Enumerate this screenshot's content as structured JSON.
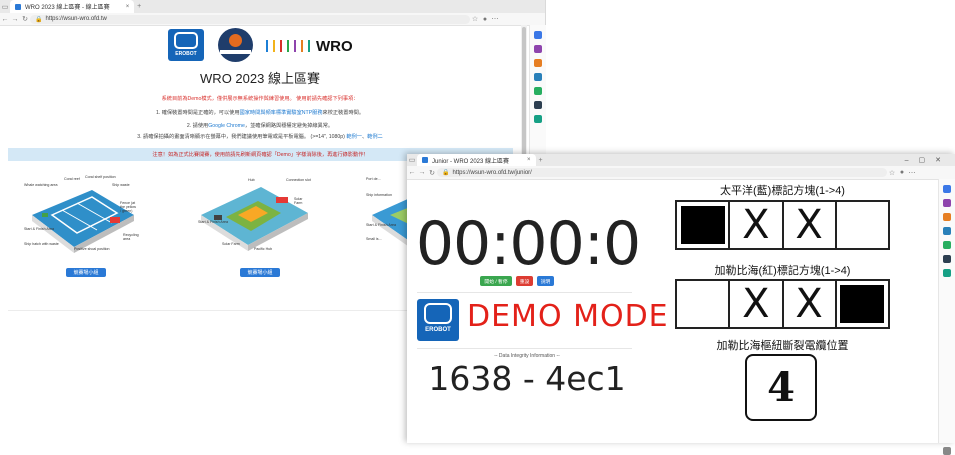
{
  "windowA": {
    "tab_title": "WRO 2023 線上區賽 - 線上區賽",
    "url": "https://wsun-wro.ofd.tw",
    "page_title": "WRO 2023 線上區賽",
    "logo_erobot": "EROBOT",
    "logo_wro": "WRO",
    "notice_red": "系統目前為Demo模式，僅供展示無系統操作與練習使用。 使用前請先確認下列事項：",
    "line1_pre": "1. 確保裝置時間是正確的，可以使用",
    "line1_link": "國家時間與頻率標準實驗室NTP服務",
    "line1_post": "來校正裝置時間。",
    "line2_pre": "2. 請使用",
    "line2_link": "Google Chrome",
    "line2_post": "，並確保網路與穩權定避免掉線異常。",
    "line3_pre": "3. 請確保拍攝的畫面清晰顯示在螢幕中，我們建議使用筆電或是平板電腦。 (>=14\", 1080p)",
    "line3_link1": "範例一",
    "line3_link2": "範例二",
    "notice_bar": "注意！如為正式比賽開賽，使用前請先刷新網頁確認「Demo」字樣消除後，再進行錄影動作！",
    "map_button_label": "競賽場小組",
    "maps": [
      {
        "labels": [
          "Whale watching area",
          "Coral reef",
          "Coral shelf position",
          "Ship waste",
          "Start & Finish Area",
          "Ship hatch with waste",
          "Positive shoal position",
          "Fence (at the yellow / green)",
          "Recycling area"
        ]
      },
      {
        "labels": [
          "Hub",
          "Connection slot",
          "Solar Farm",
          "Start & Finish Area",
          "Solar Farm",
          "Pacific Hub"
        ]
      },
      {
        "labels": [
          "Port de...",
          "Ship information",
          "Start & Finish Area",
          "Small is..."
        ]
      }
    ]
  },
  "windowB": {
    "tab_title": "Junior - WRO 2023 線上區賽",
    "url": "https://wsun-wro.ofd.tw/junior/",
    "timer": "00:00:0",
    "buttons": {
      "start_pause": "開始 / 暫停",
      "reset": "重設",
      "help": "說明"
    },
    "demo_mode": "DEMO MODE",
    "integrity_label": "-- Data Integrity Information --",
    "integrity_value": "1638 - 4ec1",
    "pacific_title": "太平洋(藍)標記方塊(1->4)",
    "pacific_cells": [
      "■",
      "X",
      "X",
      ""
    ],
    "caribbean_title": "加勒比海(紅)標記方塊(1->4)",
    "caribbean_cells": [
      "",
      "X",
      "X",
      "■"
    ],
    "cable_title": "加勒比海樞紐斷裂電纜位置",
    "cable_value": "4"
  },
  "colors": {
    "accent_blue": "#2a79d6",
    "demo_red": "#e32119",
    "reset_red": "#dd3c32",
    "start_green": "#3aa64f",
    "notice_bg": "#d4e8f6"
  }
}
